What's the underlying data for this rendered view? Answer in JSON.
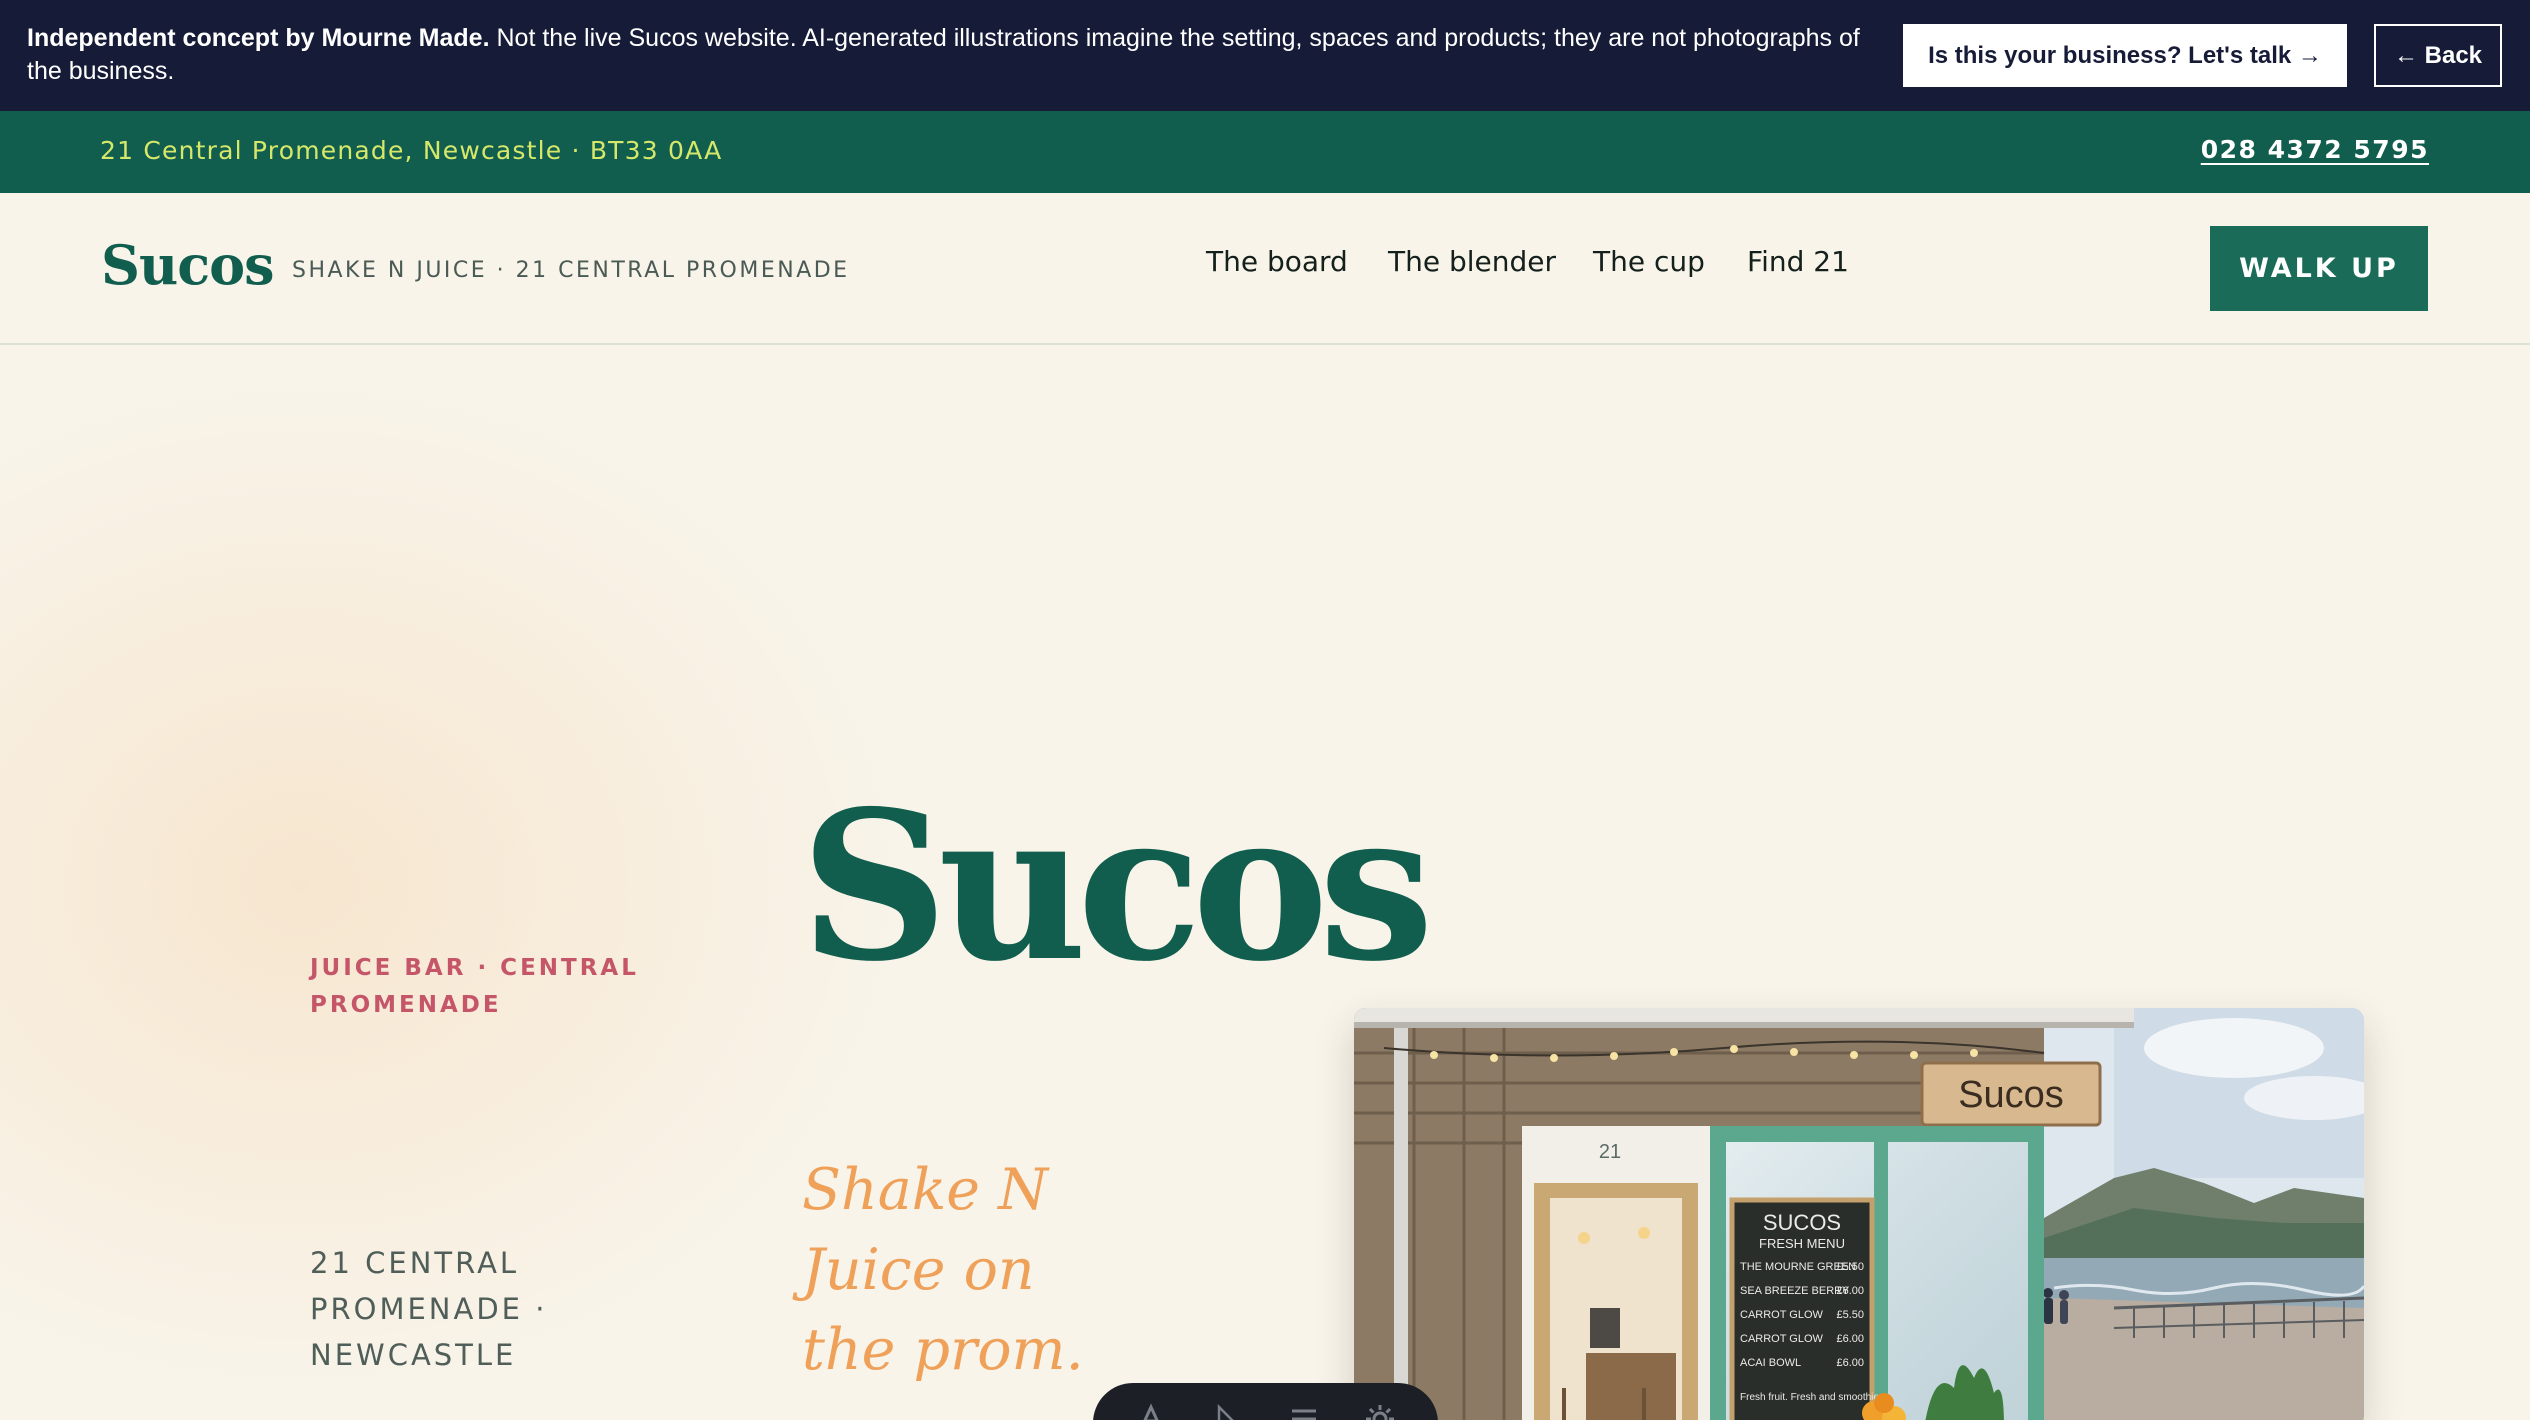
{
  "banner": {
    "bold_text": "Independent concept by Mourne Made.",
    "text": " Not the live Sucos website. AI-generated illustrations imagine the setting, spaces and products; they are not photographs of the business.",
    "cta_label": "Is this your business? Let's talk →",
    "back_label": "← Back"
  },
  "top_strip": {
    "address": "21 Central Promenade, Newcastle · BT33 0AA",
    "phone": "028 4372 5795"
  },
  "nav": {
    "brand": "Sucos",
    "tagline": "SHAKE N JUICE · 21 CENTRAL PROMENADE",
    "links": [
      "The board",
      "The blender",
      "The cup",
      "Find 21"
    ],
    "cta": "WALK UP"
  },
  "hero": {
    "eyebrow": "JUICE BAR · CENTRAL PROMENADE",
    "title": "Sucos",
    "tagline": "Shake N Juice on the prom.",
    "address": "21 CENTRAL PROMENADE · NEWCASTLE"
  },
  "illustration": {
    "sign": "Sucos",
    "door_number": "21",
    "menu_title": "SUCOS",
    "menu_subtitle": "FRESH MENU",
    "menu_items": [
      {
        "name": "THE MOURNE GREEN",
        "price": "£5.50"
      },
      {
        "name": "SEA BREEZE BERRY",
        "price": "£6.00"
      },
      {
        "name": "CARROT GLOW",
        "price": "£5.50"
      },
      {
        "name": "CARROT GLOW",
        "price": "£6.00"
      },
      {
        "name": "ACAI BOWL",
        "price": "£6.00"
      }
    ],
    "menu_footer": "Fresh fruit. Fresh and smoothies."
  },
  "toolbar": {
    "icons": [
      "text-icon",
      "pointer-icon",
      "menu-icon",
      "settings-icon"
    ]
  },
  "colors": {
    "banner_bg": "#161b38",
    "brand_green": "#125e4e",
    "address_lime": "#d6e86a",
    "eyebrow_pink": "#c5566a",
    "tagline_orange": "#efa15a",
    "page_bg": "#f8f4ea"
  }
}
